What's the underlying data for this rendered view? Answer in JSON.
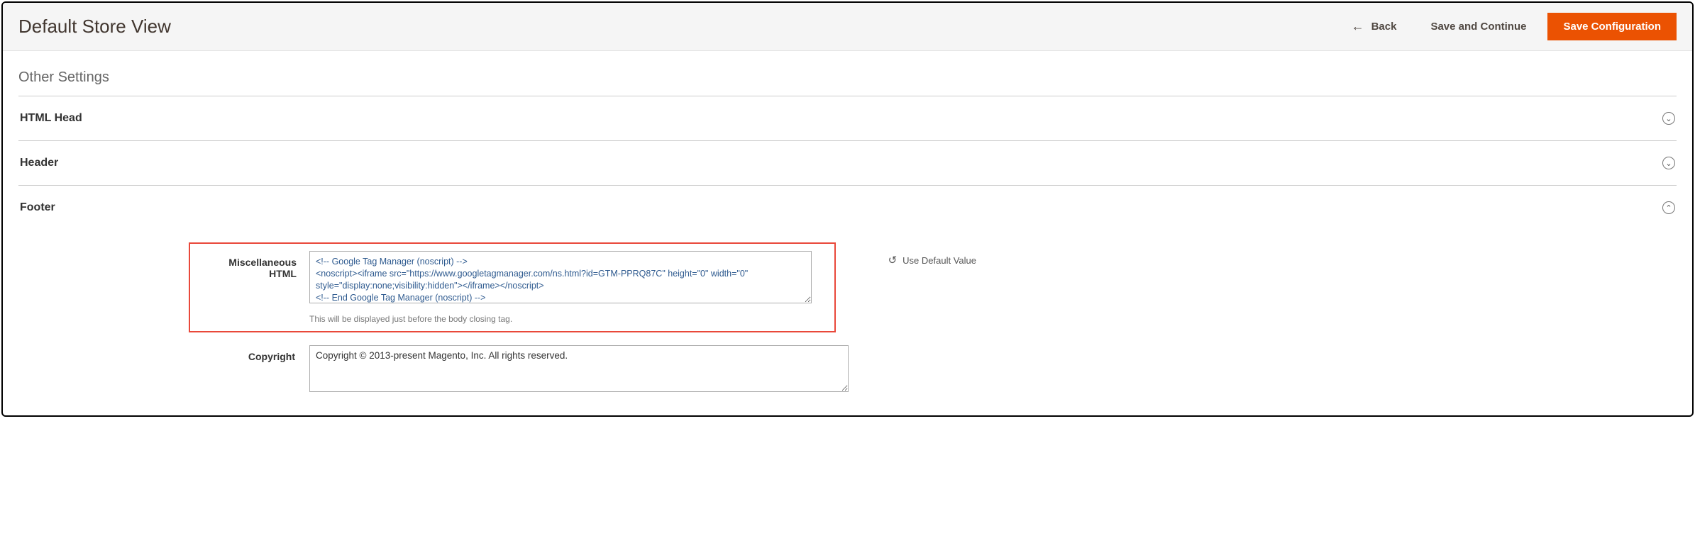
{
  "header": {
    "page_title": "Default Store View",
    "back_label": "Back",
    "save_continue_label": "Save and Continue",
    "save_config_label": "Save Configuration"
  },
  "section": {
    "title": "Other Settings"
  },
  "accordion": {
    "html_head": "HTML Head",
    "header": "Header",
    "footer": "Footer"
  },
  "footer": {
    "misc_html": {
      "label": "Miscellaneous HTML",
      "value": "<!-- Google Tag Manager (noscript) -->\n<noscript><iframe src=\"https://www.googletagmanager.com/ns.html?id=GTM-PPRQ87C\" height=\"0\" width=\"0\" style=\"display:none;visibility:hidden\"></iframe></noscript>\n<!-- End Google Tag Manager (noscript) -->",
      "hint": "This will be displayed just before the body closing tag.",
      "use_default_label": "Use Default Value"
    },
    "copyright": {
      "label": "Copyright",
      "value": "Copyright © 2013-present Magento, Inc. All rights reserved."
    }
  }
}
